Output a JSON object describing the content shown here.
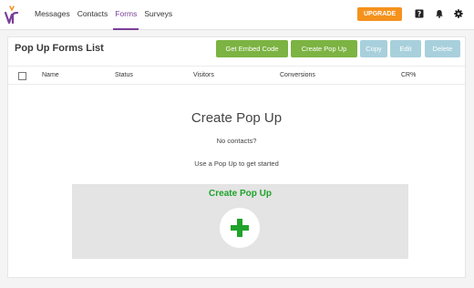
{
  "nav": {
    "items": [
      {
        "label": "Messages",
        "active": false
      },
      {
        "label": "Contacts",
        "active": false
      },
      {
        "label": "Forms",
        "active": true
      },
      {
        "label": "Surveys",
        "active": false
      }
    ],
    "upgrade_label": "UPGRADE"
  },
  "page": {
    "title": "Pop Up Forms List"
  },
  "toolbar": {
    "embed_label": "Get Embed Code",
    "create_label": "Create Pop Up",
    "copy_label": "Copy",
    "edit_label": "Edit",
    "delete_label": "Delete"
  },
  "table": {
    "columns": [
      "Name",
      "Status",
      "Visitors",
      "Conversions",
      "CR%"
    ]
  },
  "empty_state": {
    "title": "Create Pop Up",
    "subtitle": "No contacts?",
    "hint": "Use a Pop Up to get started",
    "card_title": "Create Pop Up"
  },
  "colors": {
    "brand_purple": "#7a3f9a",
    "upgrade_orange": "#f5921e",
    "button_green": "#7cb342",
    "button_disabled": "#a8d0dc",
    "plus_green": "#1fa32b"
  }
}
